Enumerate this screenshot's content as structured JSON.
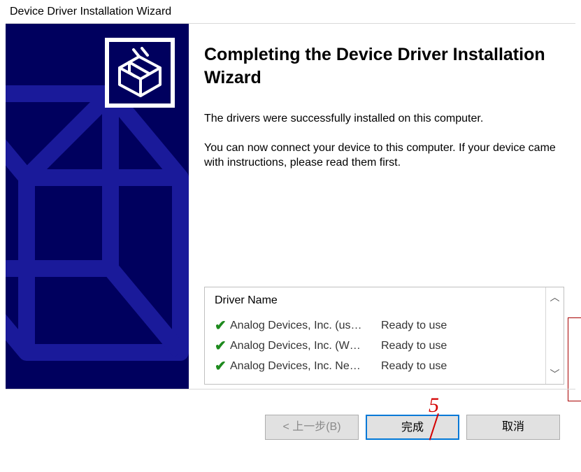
{
  "title": "Device Driver Installation Wizard",
  "heading": "Completing the Device Driver Installation Wizard",
  "para1": "The drivers were successfully installed on this computer.",
  "para2": "You can now connect your device to this computer. If your device came with instructions, please read them first.",
  "listHeader": "Driver Name",
  "drivers": [
    {
      "name": "Analog Devices, Inc. (us…",
      "status": "Ready to use"
    },
    {
      "name": "Analog Devices, Inc. (W…",
      "status": "Ready to use"
    },
    {
      "name": "Analog Devices, Inc. Ne…",
      "status": "Ready to use"
    }
  ],
  "buttons": {
    "back": "< 上一步(B)",
    "finish": "完成",
    "cancel": "取消"
  },
  "annotation": "5"
}
